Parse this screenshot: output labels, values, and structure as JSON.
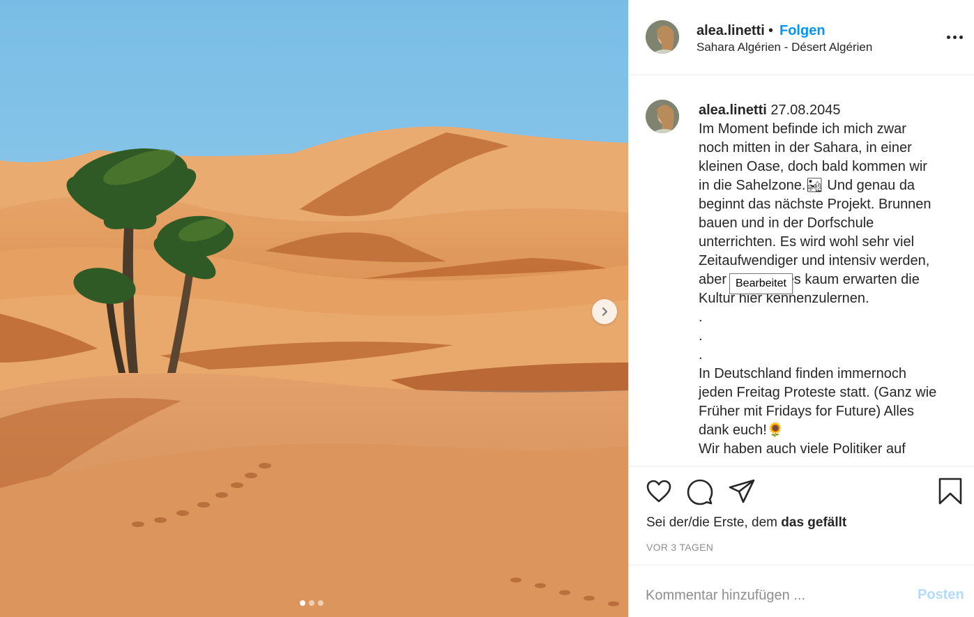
{
  "post": {
    "image_alt": "Sahara desert dunes with palm trees",
    "carousel": {
      "total": 3,
      "active": 1
    }
  },
  "header": {
    "username": "alea.linetti",
    "bullet": "•",
    "follow_label": "Folgen",
    "location": "Sahara Algérien - Désert Algérien"
  },
  "caption": {
    "username": "alea.linetti",
    "date": "27.08.2045",
    "text": "Im Moment befinde ich mich zwar\nnoch mitten in der Sahara, in einer\nkleinen Oase, doch bald kommen wir\nin die Sahelzone.🏜 Und genau da\nbeginnt das nächste Projekt. Brunnen\nbauen und in der Dorfschule\nunterrichten. Es wird wohl sehr viel\nZeitaufwendiger und intensiv werden,\naber ich kann es kaum erwarten die\nKultur hier kennenzulernen.\n.\n.\n.\nIn Deutschland finden immernoch\njeden Freitag Proteste statt. (Ganz wie\nFrüher mit Fridays for Future) Alles\ndank euch!🌻\nWir haben auch viele Politiker auf",
    "tooltip": "Bearbeitet"
  },
  "actions": {
    "likes_prefix": "Sei der/die Erste, dem ",
    "likes_bold": "das gefällt",
    "age": "VOR 3 TAGEN"
  },
  "comment": {
    "placeholder": "Kommentar hinzufügen ...",
    "post_label": "Posten"
  },
  "colors": {
    "accent": "#0095f6",
    "post_disabled": "#b3dbff",
    "secondary_text": "#8e8e8e",
    "divider": "#efefef"
  },
  "icons": [
    "chevron-right-icon",
    "more-options-icon",
    "heart-icon",
    "comment-icon",
    "share-icon",
    "bookmark-icon"
  ]
}
